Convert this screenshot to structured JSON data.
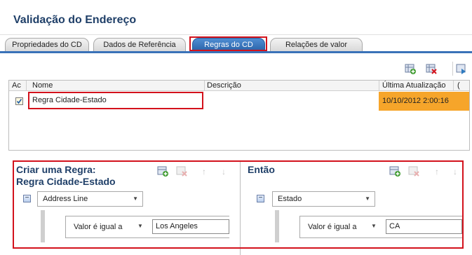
{
  "page": {
    "title": "Validação do Endereço"
  },
  "tabs": [
    {
      "label": "Propriedades do CD",
      "active": false
    },
    {
      "label": "Dados de Referência",
      "active": false
    },
    {
      "label": "Regras do CD",
      "active": true
    },
    {
      "label": "Relações de valor",
      "active": false
    }
  ],
  "toolbar": {
    "icons": [
      "add-rule-icon",
      "delete-rule-icon",
      "run-rule-icon"
    ]
  },
  "grid": {
    "columns": [
      "Ac",
      "Nome",
      "Descrição",
      "Última Atualização"
    ],
    "rows": [
      {
        "active": true,
        "name": "Regra Cidade-Estado",
        "description": "",
        "updated": "10/10/2012 2:00:16"
      }
    ]
  },
  "create_rule": {
    "title_line1": "Criar uma Regra:",
    "title_line2": "Regra Cidade-Estado",
    "field": "Address Line",
    "operator": "Valor é igual a",
    "value": "Los Angeles"
  },
  "then": {
    "title": "Então",
    "field": "Estado",
    "operator": "Valor é igual a",
    "value": "CA"
  },
  "colors": {
    "accent": "#2a62a8",
    "highlight_border": "#d3121c",
    "selected_row": "#f6a52a",
    "title": "#1f3f68"
  }
}
